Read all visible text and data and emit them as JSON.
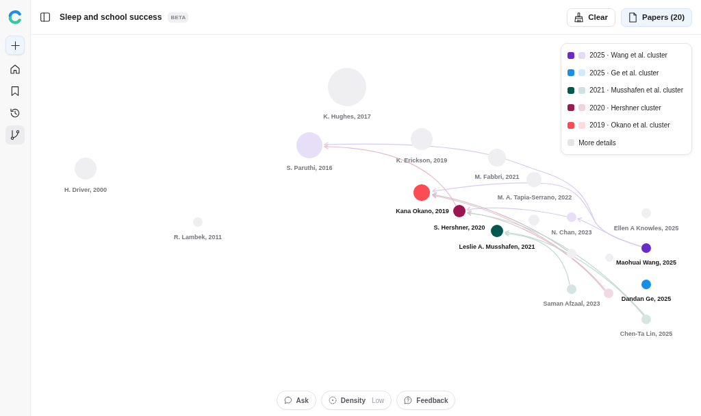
{
  "sidebar": {
    "items": [
      {
        "kind": "new",
        "selected": false
      },
      {
        "kind": "home",
        "selected": false
      },
      {
        "kind": "saved",
        "selected": false
      },
      {
        "kind": "history",
        "selected": false
      },
      {
        "kind": "graph",
        "selected": true
      }
    ]
  },
  "header": {
    "title": "Sleep and school success",
    "badge": "BETA",
    "buttons": [
      {
        "kind": "clear",
        "label": "Clear",
        "selected": false
      },
      {
        "kind": "papers",
        "label": "Papers (20)",
        "selected": true
      }
    ]
  },
  "legend": {
    "items": [
      {
        "label": "2025 · Wang et al. cluster",
        "swatches": [
          {
            "color": "#6a2bc8"
          },
          {
            "color": "#e4dbf5"
          }
        ]
      },
      {
        "label": "2025 · Ge et al. cluster",
        "swatches": [
          {
            "color": "#1a8fe9"
          },
          {
            "color": "#d4eafb"
          }
        ]
      },
      {
        "label": "2021 · Musshafen et al. cluster",
        "swatches": [
          {
            "color": "#00584f"
          },
          {
            "color": "#cfe2df"
          }
        ]
      },
      {
        "label": "2020 · Hershner cluster",
        "swatches": [
          {
            "color": "#9b1a50"
          },
          {
            "color": "#f0d3df"
          }
        ]
      },
      {
        "label": "2019 · Okano et al. cluster",
        "swatches": [
          {
            "color": "#fb4b55"
          },
          {
            "color": "#fddadb"
          }
        ]
      },
      {
        "label": "More details",
        "swatches": [
          {
            "color": "#e4e4e7"
          }
        ]
      }
    ]
  },
  "nodes": [
    {
      "label": "K. Hughes, 2017",
      "color": "#efeff1",
      "highlighted": false
    },
    {
      "label": "S. Paruthi, 2016",
      "color": "#e6dff7",
      "highlighted": false
    },
    {
      "label": "K. Erickson, 2019",
      "color": "#efeff1",
      "highlighted": false
    },
    {
      "label": "M. Fabbri, 2021",
      "color": "#efeff1",
      "highlighted": false
    },
    {
      "label": "M. A. Tapia-Serrano, 2022",
      "color": "#efeff1",
      "highlighted": false
    },
    {
      "label": "Kana Okano, 2019",
      "color": "#fb4b55",
      "highlighted": true
    },
    {
      "label": "S. Hershner, 2020",
      "color": "#9b154e",
      "highlighted": true
    },
    {
      "label": "Leslie A. Musshafen, 2021",
      "color": "#00584f",
      "highlighted": true
    },
    {
      "color": "#efeff1"
    },
    {
      "label": "N. Chan, 2023",
      "color": "#e6dff7",
      "highlighted": false
    },
    {
      "label": "Ellen A Knowles, 2025",
      "color": "#efeff1",
      "highlighted": false
    },
    {
      "label": "Maohuai Wang, 2025",
      "color": "#6a2bc8",
      "highlighted": true
    },
    {
      "color": "#efeff1"
    },
    {
      "color": "#efeff1"
    },
    {
      "label": "Dandan Ge, 2025",
      "color": "#168fe8",
      "highlighted": true
    },
    {
      "label": "Saman Afzaal, 2023",
      "color": "#d4e5e2",
      "highlighted": false
    },
    {
      "color": "#f0d9e2"
    },
    {
      "label": "Chen-Ta Lin, 2025",
      "color": "#d4e5e2",
      "highlighted": false
    },
    {
      "label": "H. Driver, 2000",
      "color": "#efeff1",
      "highlighted": false
    },
    {
      "label": "R. Lambek, 2011",
      "color": "#efeff1",
      "highlighted": false
    }
  ],
  "toolbar": {
    "buttons": [
      {
        "kind": "ask",
        "label": "Ask"
      },
      {
        "kind": "density",
        "label": "Density",
        "value": "Low"
      },
      {
        "kind": "feedback",
        "label": "Feedback"
      }
    ]
  }
}
